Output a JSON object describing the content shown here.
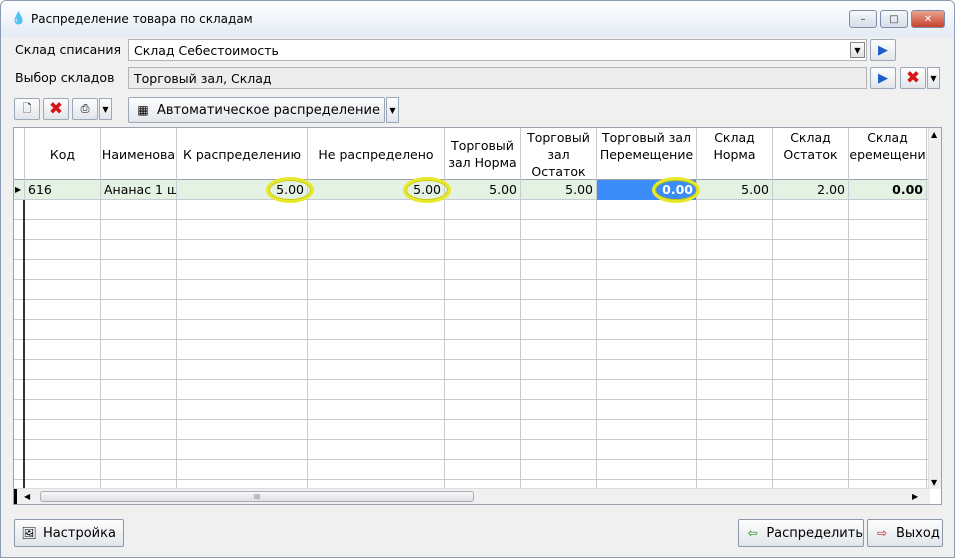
{
  "window": {
    "title": "Распределение товара по складам"
  },
  "form": {
    "sklad_spisaniya_label": "Склад списания",
    "sklad_spisaniya_value": "Склад Себестоимость",
    "vybor_skladov_label": "Выбор складов",
    "vybor_skladov_value": "Торговый зал, Склад"
  },
  "toolbar": {
    "auto_label": "Автоматическое распределение"
  },
  "grid": {
    "headers": {
      "kod": "Код",
      "name": "Наименова",
      "k_raspr": "К распределению",
      "ne_raspr": "Не распределено",
      "tz_norma_1": "Торговый",
      "tz_norma_2": "зал Норма",
      "tz_ost_1": "Торговый",
      "tz_ost_2": "зал",
      "tz_ost_3": "Остаток",
      "tz_per_1": "Торговый зал",
      "tz_per_2": "Перемещение",
      "sk_norma_1": "Склад",
      "sk_norma_2": "Норма",
      "sk_ost_1": "Склад",
      "sk_ost_2": "Остаток",
      "sk_per_1": "Склад",
      "sk_per_2": "еремещени"
    },
    "row": {
      "kod": "616",
      "name": "Ананас 1 ш",
      "k_raspr": "5.00",
      "ne_raspr": "5.00",
      "tz_norma": "5.00",
      "tz_ost": "5.00",
      "tz_per": "0.00",
      "sk_norma": "5.00",
      "sk_ost": "2.00",
      "sk_per": "0.00"
    }
  },
  "scroll": {
    "thumb_grip": "III"
  },
  "footer": {
    "settings_label": "Настройка",
    "distribute_label": "Распределить",
    "exit_label": "Выход"
  },
  "colors": {
    "active_cell": "#3b8cf6",
    "selected_row": "#e3f2e3",
    "highlight_ring": "#e8e82a"
  }
}
